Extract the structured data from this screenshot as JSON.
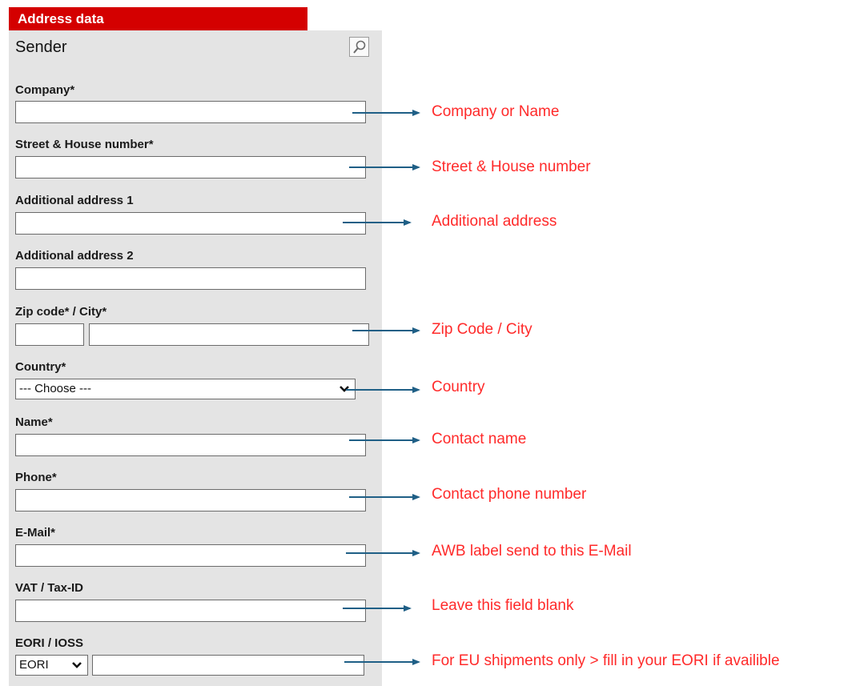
{
  "header": {
    "title": "Address data"
  },
  "section": {
    "title": "Sender",
    "search_icon": "magnifier-icon"
  },
  "fields": {
    "company": {
      "label": "Company*",
      "value": ""
    },
    "street": {
      "label": "Street & House number*",
      "value": ""
    },
    "additional1": {
      "label": "Additional address 1",
      "value": ""
    },
    "additional2": {
      "label": "Additional address 2",
      "value": ""
    },
    "zip_city": {
      "label": "Zip code* / City*",
      "zip_value": "",
      "city_value": ""
    },
    "country": {
      "label": "Country*",
      "selected": "--- Choose ---"
    },
    "name": {
      "label": "Name*",
      "value": ""
    },
    "phone": {
      "label": "Phone*",
      "value": ""
    },
    "email": {
      "label": "E-Mail*",
      "value": ""
    },
    "vat": {
      "label": "VAT / Tax-ID",
      "value": ""
    },
    "eori": {
      "label": "EORI / IOSS",
      "type_selected": "EORI",
      "value": ""
    }
  },
  "annotations": {
    "company": "Company or Name",
    "street": "Street & House number",
    "additional": "Additional address",
    "zip_city": "Zip Code / City",
    "country": "Country",
    "name": "Contact name",
    "phone": "Contact phone number",
    "email": "AWB label send to this E-Mail",
    "vat": "Leave this field blank",
    "eori": "For EU shipments only > fill in your EORI if availible"
  },
  "colors": {
    "header_bg": "#d40000",
    "panel_bg": "#e4e4e4",
    "annotation_text": "#ff2a2a",
    "arrow": "#1f5f86"
  }
}
